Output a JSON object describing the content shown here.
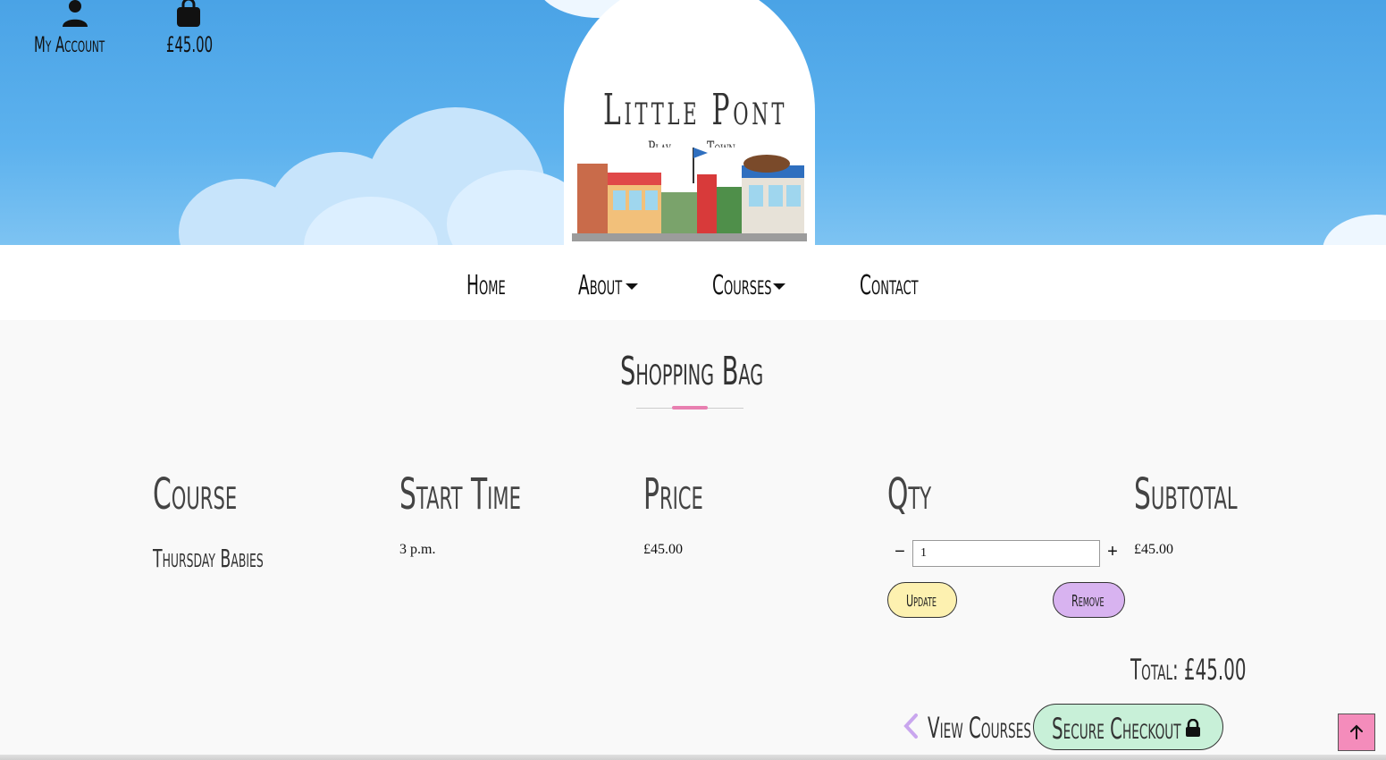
{
  "header": {
    "account_label": "My Account",
    "bag_total": "£45.00",
    "logo": {
      "line1": "Little Pont",
      "line2a": "Play",
      "line2b": "Town"
    }
  },
  "nav": {
    "items": [
      {
        "label": "Home"
      },
      {
        "label": "About"
      },
      {
        "label": "Courses"
      },
      {
        "label": "Contact"
      }
    ]
  },
  "page": {
    "title": "Shopping Bag"
  },
  "table": {
    "headers": [
      "Course",
      "Start Time",
      "Price",
      "Qty",
      "Subtotal"
    ],
    "rows": [
      {
        "course": "Thursday Babies",
        "start_time": "3 p.m.",
        "price": "£45.00",
        "qty": "1",
        "subtotal": "£45.00"
      }
    ]
  },
  "actions": {
    "update_label": "Update",
    "remove_label": "Remove",
    "qty_minus": "−",
    "qty_plus": "+"
  },
  "summary": {
    "total": "Total: £45.00"
  },
  "footer_buttons": {
    "view_courses": "View Courses",
    "secure_checkout": "Secure Checkout"
  },
  "colors": {
    "sky": "#4aa3e6",
    "accent_pink": "#e87fb0",
    "update_bg": "#fdf1b0",
    "remove_bg": "#d8b3f0",
    "checkout_bg": "#c8f0d8",
    "to_top_bg": "#f48cbb"
  },
  "icons": {
    "account": "user-icon",
    "bag": "shopping-bag-icon",
    "back": "chevron-left-icon",
    "lock": "lock-icon",
    "to_top": "arrow-up-icon"
  }
}
